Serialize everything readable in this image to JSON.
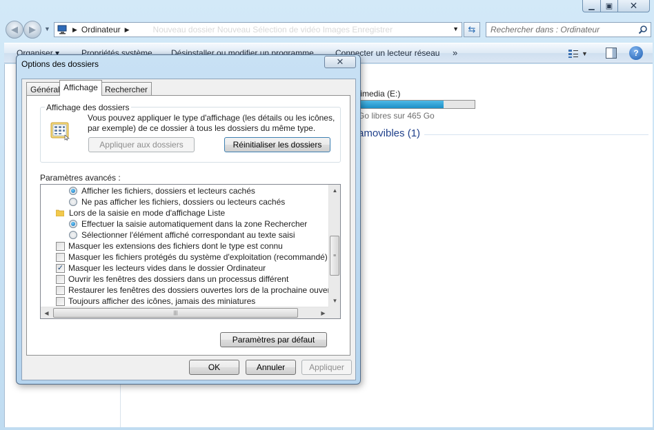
{
  "explorer": {
    "address": {
      "location": "Ordinateur",
      "ghost_text": "Nouveau dossier   Nouveau   Sélection de vidéo   Images   Enregistrer"
    },
    "search": {
      "placeholder": "Rechercher dans : Ordinateur"
    },
    "toolbar": {
      "items": [
        "Organiser ▾",
        "Propriétés système",
        "Désinstaller ou modifier un programme",
        "Connecter un lecteur réseau"
      ],
      "more": "»"
    },
    "drive": {
      "name": "timedia (E:)",
      "free_text": "Go libres sur 465 Go",
      "used_fraction": 0.73
    },
    "removable_header": "amovibles (1)"
  },
  "dialog": {
    "title": "Options des dossiers",
    "tabs": [
      {
        "label": "Général",
        "active": false
      },
      {
        "label": "Affichage",
        "active": true
      },
      {
        "label": "Rechercher",
        "active": false
      }
    ],
    "folder_view": {
      "group_title": "Affichage des dossiers",
      "description": "Vous pouvez appliquer le type d'affichage (les détails ou les icônes, par exemple) de ce dossier à tous les dossiers du même type.",
      "apply_button": "Appliquer aux dossiers",
      "reset_button": "Réinitialiser les dossiers"
    },
    "advanced_label": "Paramètres avancés :",
    "advanced_items": [
      {
        "type": "radio",
        "checked": true,
        "label": "Afficher les fichiers, dossiers et lecteurs cachés"
      },
      {
        "type": "radio",
        "checked": false,
        "label": "Ne pas afficher les fichiers, dossiers ou lecteurs cachés"
      },
      {
        "type": "folder",
        "label": "Lors de la saisie en mode d'affichage Liste"
      },
      {
        "type": "radio",
        "checked": true,
        "label": "Effectuer la saisie automatiquement dans la zone Rechercher"
      },
      {
        "type": "radio",
        "checked": false,
        "label": "Sélectionner l'élément affiché correspondant au texte saisi"
      },
      {
        "type": "check",
        "checked": false,
        "label": "Masquer les extensions des fichiers dont le type est connu"
      },
      {
        "type": "check",
        "checked": false,
        "label": "Masquer les fichiers protégés du système d'exploitation (recommandé)"
      },
      {
        "type": "check",
        "checked": true,
        "label": "Masquer les lecteurs vides dans le dossier Ordinateur"
      },
      {
        "type": "check",
        "checked": false,
        "label": "Ouvrir les fenêtres des dossiers dans un processus différent"
      },
      {
        "type": "check",
        "checked": false,
        "label": "Restaurer les fenêtres des dossiers ouvertes lors de la prochaine ouverture de session"
      },
      {
        "type": "check",
        "checked": false,
        "label": "Toujours afficher des icônes, jamais des miniatures"
      }
    ],
    "defaults_button": "Paramètres par défaut",
    "ok_button": "OK",
    "cancel_button": "Annuler",
    "apply_button": "Appliquer"
  },
  "colors": {
    "accent": "#3c7fb1",
    "drive_fill": "#1c8fc7",
    "link_header": "#1e3f8a"
  }
}
